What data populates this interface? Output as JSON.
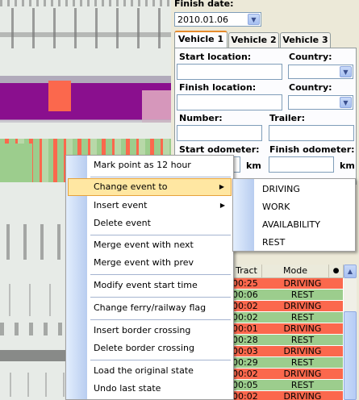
{
  "finish_date": {
    "label": "Finish date:",
    "value": "2010.01.06"
  },
  "tabs": [
    "Vehicle 1",
    "Vehicle 2",
    "Vehicle 3"
  ],
  "form": {
    "start_location": "Start location:",
    "country1": "Country:",
    "finish_location": "Finish location:",
    "country2": "Country:",
    "number": "Number:",
    "trailer": "Trailer:",
    "start_odometer": "Start odometer:",
    "finish_odometer": "Finish odometer:",
    "km1": "km",
    "km2": "km"
  },
  "grid": {
    "headers": [
      "Tract",
      "Mode",
      "●"
    ],
    "rows": [
      {
        "time": "00:25",
        "mode": "DRIVING"
      },
      {
        "time": "00:06",
        "mode": "REST"
      },
      {
        "time": "00:02",
        "mode": "DRIVING"
      },
      {
        "time": "00:02",
        "mode": "REST"
      },
      {
        "time": "00:01",
        "mode": "DRIVING"
      },
      {
        "time": "00:28",
        "mode": "REST"
      },
      {
        "time": "00:03",
        "mode": "DRIVING"
      },
      {
        "time": "00:29",
        "mode": "REST"
      },
      {
        "time": "00:02",
        "mode": "DRIVING"
      },
      {
        "time": "00:05",
        "mode": "REST"
      },
      {
        "time": "00:02",
        "mode": "DRIVING"
      }
    ]
  },
  "context_menu": {
    "items": [
      "Mark point as 12 hour",
      "Change event to",
      "Insert event",
      "Delete event",
      "Merge event with next",
      "Merge event with prev",
      "Modify event start time",
      "Change ferry/railway flag",
      "Insert border crossing",
      "Delete border crossing",
      "Load the original state",
      "Undo last state"
    ]
  },
  "submenu": {
    "items": [
      "DRIVING",
      "WORK",
      "AVAILABILITY",
      "REST"
    ]
  },
  "colors": {
    "driving": "#fb684d",
    "rest": "#9ccd8d",
    "highlight": "#ffe7a2",
    "tab_accent": "#e68b2c"
  }
}
